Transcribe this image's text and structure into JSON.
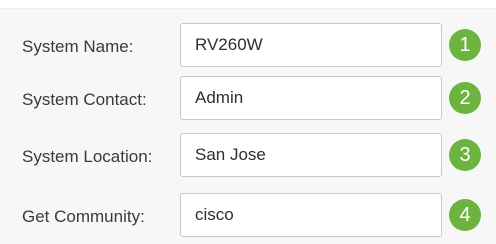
{
  "form": {
    "fields": [
      {
        "label": "System Name:",
        "value": "RV260W",
        "step": "1"
      },
      {
        "label": "System Contact:",
        "value": "Admin",
        "step": "2"
      },
      {
        "label": "System Location:",
        "value": "San Jose",
        "step": "3"
      },
      {
        "label": "Get Community:",
        "value": "cisco",
        "step": "4"
      }
    ]
  },
  "colors": {
    "badge": "#6cb33f",
    "background": "#f7f7f7"
  }
}
